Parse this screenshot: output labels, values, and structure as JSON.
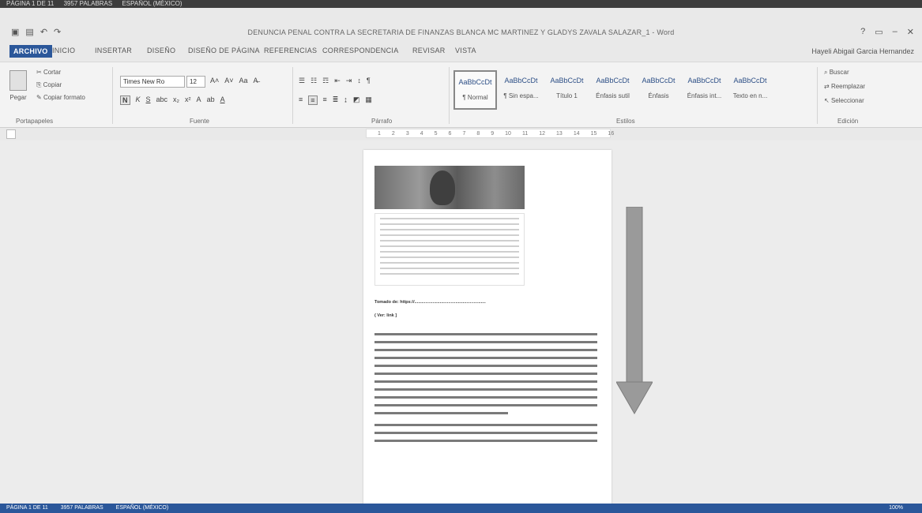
{
  "status_top": {
    "page": "PÁGINA 1 DE 11",
    "words": "3957 PALABRAS",
    "lang": "ESPAÑOL (MÉXICO)"
  },
  "titlebar": {
    "title": "DENUNCIA PENAL CONTRA LA SECRETARIA DE FINANZAS BLANCA MC MARTINEZ Y GLADYS ZAVALA SALAZAR_1 - Word",
    "help": "?",
    "restore": "▭",
    "minimize": "–",
    "close": "✕"
  },
  "tabs": {
    "archivo": "ARCHIVO",
    "inicio": "INICIO",
    "insertar": "INSERTAR",
    "diseno": "DISEÑO",
    "diseno_pagina": "DISEÑO DE PÁGINA",
    "referencias": "REFERENCIAS",
    "correspondencia": "CORRESPONDENCIA",
    "revisar": "REVISAR",
    "vista": "VISTA"
  },
  "user": "Hayeli Abigail Garcia Hernandez",
  "clipboard": {
    "paste": "Pegar",
    "cut": "Cortar",
    "copy": "Copiar",
    "format_painter": "Copiar formato",
    "label": "Portapapeles"
  },
  "font": {
    "name": "Times New Ro",
    "size": "12",
    "label": "Fuente"
  },
  "paragraph": {
    "label": "Párrafo"
  },
  "styles": {
    "label": "Estilos",
    "items": [
      {
        "sample": "AaBbCcDt",
        "name": "¶ Normal"
      },
      {
        "sample": "AaBbCcDt",
        "name": "¶ Sin espa..."
      },
      {
        "sample": "AaBbCcDt",
        "name": "Título 1"
      },
      {
        "sample": "AaBbCcDt",
        "name": "Énfasis sutil"
      },
      {
        "sample": "AaBbCcDt",
        "name": "Énfasis"
      },
      {
        "sample": "AaBbCcDt",
        "name": "Énfasis int..."
      },
      {
        "sample": "AaBbCcDt",
        "name": "Texto en n..."
      }
    ]
  },
  "editing": {
    "label": "Edición",
    "find": "Buscar",
    "replace": "Reemplazar",
    "select": "Seleccionar"
  },
  "ruler": [
    "1",
    "2",
    "3",
    "4",
    "5",
    "6",
    "7",
    "8",
    "9",
    "10",
    "11",
    "12",
    "13",
    "14",
    "15",
    "16"
  ],
  "document": {
    "caption_line1": "Tomado de: https://...........................................................",
    "caption_line2": "( Ver: link ]"
  },
  "statusbar": {
    "page": "PÁGINA 1 DE 11",
    "words": "3957 PALABRAS",
    "lang": "ESPAÑOL (MÉXICO)",
    "zoom": "100%"
  },
  "colors": {
    "accent": "#2b579a",
    "arrow": "#9a9a9a"
  }
}
